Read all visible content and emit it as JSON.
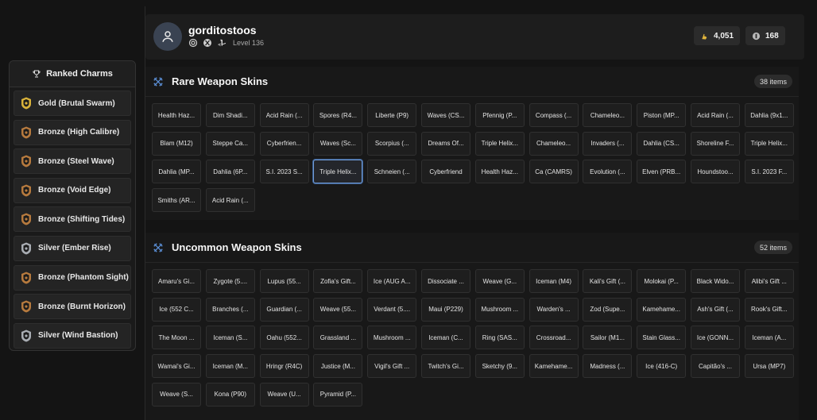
{
  "sidebar": {
    "title": "Ranked Charms",
    "charms": [
      {
        "label": "Gold (Brutal Swarm)",
        "tier": "gold"
      },
      {
        "label": "Bronze (High Calibre)",
        "tier": "bronze"
      },
      {
        "label": "Bronze (Steel Wave)",
        "tier": "bronze"
      },
      {
        "label": "Bronze (Void Edge)",
        "tier": "bronze"
      },
      {
        "label": "Bronze (Shifting Tides)",
        "tier": "bronze"
      },
      {
        "label": "Silver (Ember Rise)",
        "tier": "silver"
      },
      {
        "label": "Bronze (Phantom Sight)",
        "tier": "bronze"
      },
      {
        "label": "Bronze (Burnt Horizon)",
        "tier": "bronze"
      },
      {
        "label": "Silver (Wind Bastion)",
        "tier": "silver"
      }
    ]
  },
  "profile": {
    "username": "gorditostoos",
    "level": "Level 136",
    "platform_icons": [
      "ubisoft-icon",
      "xbox-icon",
      "playstation-icon"
    ],
    "renown": "4,051",
    "credits": "168"
  },
  "rare": {
    "title": "Rare Weapon Skins",
    "count": "38 items",
    "selected_index": 30,
    "items": [
      "Health Haz...",
      "Dim Shadi...",
      "Acid Rain (...",
      "Spores (R4...",
      "Liberte (P9)",
      "Waves (CS...",
      "Pfennig (P...",
      "Compass (...",
      "Chameleo...",
      "Piston (MP...",
      "Acid Rain (...",
      "Dahlia (9x1...",
      "Blam (M12)",
      "Steppe Ca...",
      "Cyberfrien...",
      "Waves (Sc...",
      "Scorpius (...",
      "Dreams Of...",
      "Triple Helix...",
      "Chameleo...",
      "Invaders (...",
      "Dahlia (CS...",
      "Shoreline F...",
      "Triple Helix...",
      "Dahlia (MP...",
      "Dahlia (6P...",
      "S.I. 2023 S...",
      "Triple Helix...",
      "Schneien (...",
      "Cyberfriend",
      "Health Haz...",
      "Ca (CAMRS)",
      "Evolution (...",
      "Elven (PRB...",
      "Houndstoo...",
      "S.I. 2023 F...",
      "Smiths (AR...",
      "Acid Rain (..."
    ]
  },
  "uncommon": {
    "title": "Uncommon Weapon Skins",
    "count": "52 items",
    "items": [
      "Amaru's Gi...",
      "Zygote (5....",
      "Lupus (55...",
      "Zofia's Gift...",
      "Ice (AUG A...",
      "Dissociate ...",
      "Weave (G...",
      "Iceman (M4)",
      "Kali's Gift (...",
      "Molokai (P...",
      "Black Wido...",
      "Alibi's Gift ...",
      "Ice (552 C...",
      "Branches (...",
      "Guardian (...",
      "Weave (55...",
      "Verdant (5....",
      "Maui (P229)",
      "Mushroom ...",
      "Warden's ...",
      "Zod (Supe...",
      "Kamehame...",
      "Ash's Gift (...",
      "Rook's Gift...",
      "The Moon ...",
      "Iceman (S...",
      "Oahu (552...",
      "Grassland ...",
      "Mushroom ...",
      "Iceman (C...",
      "Ring (SAS...",
      "Crossroad...",
      "Sailor (M1...",
      "Stain Glass...",
      "Ice (GONN...",
      "Iceman (A...",
      "Wamai's Gi...",
      "Iceman (M...",
      "Hringr (R4C)",
      "Justice (M...",
      "Vigil's Gift ...",
      "Twitch's Gi...",
      "Sketchy (9...",
      "Kamehame...",
      "Madness (...",
      "Ice (416-C)",
      "Capitão's ...",
      "Ursa (MP7)",
      "Weave (S...",
      "Kona (P90)",
      "Weave (U...",
      "Pyramid (P..."
    ]
  },
  "colors": {
    "gold": "#d9b23a",
    "bronze": "#b67a3e",
    "silver": "#a9adb3",
    "accent": "#6f9bd8"
  }
}
